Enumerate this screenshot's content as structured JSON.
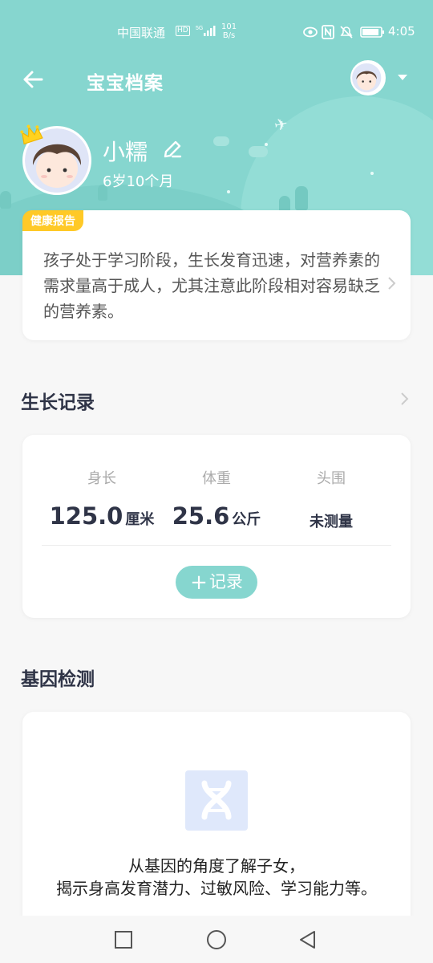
{
  "status_bar": {
    "carrier": "中国联通",
    "hd_badge": "HD",
    "network": "5G",
    "speed_value": "101",
    "speed_unit": "B/s",
    "time": "4:05"
  },
  "header": {
    "title": "宝宝档案",
    "back_icon": "arrow-left-icon",
    "switch_icon": "caret-down-icon"
  },
  "profile": {
    "name": "小糯",
    "age": "6岁10个月",
    "edit_icon": "pencil-icon",
    "badge_icon": "crown-icon"
  },
  "health_report": {
    "tag": "健康报告",
    "text": "孩子处于学习阶段，生长发育迅速，对营养素的需求量高于成人，尤其注意此阶段相对容易缺乏的营养素。"
  },
  "growth": {
    "section_title": "生长记录",
    "metrics": [
      {
        "label": "身长",
        "value": "125.0",
        "unit": "厘米"
      },
      {
        "label": "体重",
        "value": "25.6",
        "unit": "公斤"
      },
      {
        "label": "头围",
        "value": "未测量",
        "unit": ""
      }
    ],
    "record_button": {
      "icon": "+",
      "label": "记录"
    }
  },
  "gene": {
    "section_title": "基因检测",
    "icon": "dna-icon",
    "line1": "从基因的角度了解子女，",
    "line2": "揭示身高发育潜力、过敏风险、学习能力等。"
  },
  "colors": {
    "accent": "#86d6cf",
    "tag": "#ffc927",
    "title": "#2f3447"
  },
  "system_nav": [
    "square-icon",
    "circle-icon",
    "triangle-back-icon"
  ]
}
